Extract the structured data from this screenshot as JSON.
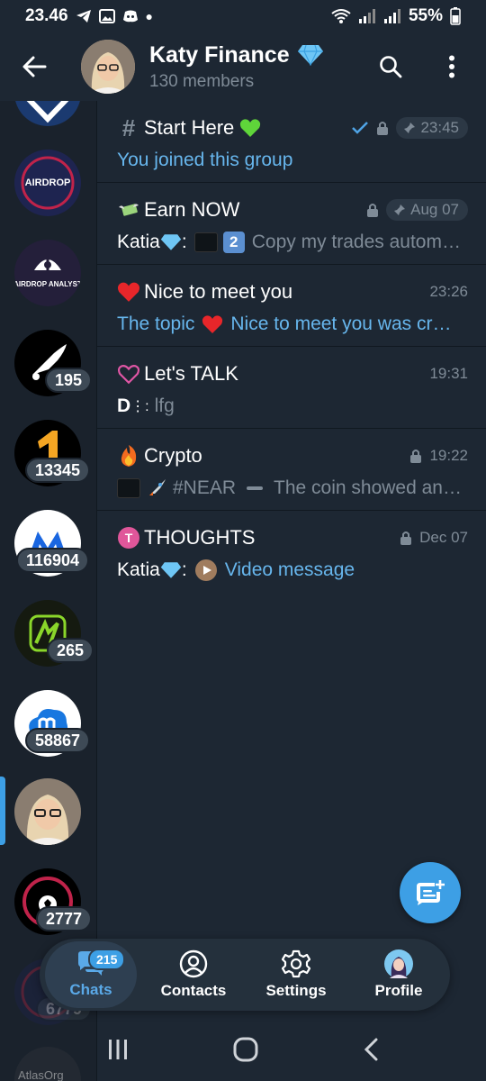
{
  "status_bar": {
    "time": "23.46",
    "battery": "55%"
  },
  "header": {
    "title": "Katy Finance",
    "subtitle": "130 members"
  },
  "rail": {
    "badges": [
      "195",
      "13345",
      "116904",
      "265",
      "58867",
      "2777"
    ],
    "faded_badge": "6779",
    "bottom_label": "AtlasOrg",
    "airdrop_sat_text": "AIRDROP",
    "airdrop_analyst_text": "AIRDROP ANALYST"
  },
  "topics": [
    {
      "title": "Start Here",
      "time": "23:45",
      "preview": "You joined this group"
    },
    {
      "title": "Earn NOW",
      "time": "Aug 07",
      "sender": "Katia",
      "preview": "Copy my trades autom…"
    },
    {
      "title": "Nice to meet you",
      "time": "23:26",
      "preview": "The topic",
      "preview_rest": "Nice to meet you was cr…"
    },
    {
      "title": "Let's TALK",
      "time": "19:31",
      "sender": "D",
      "preview": "lfg"
    },
    {
      "title": "Crypto",
      "time": "19:22",
      "preview": "#NEAR",
      "preview_rest": "The coin showed an…"
    },
    {
      "title": "THOUGHTS",
      "time": "Dec 07",
      "sender": "Katia",
      "preview": "Video message",
      "icon_letter": "T"
    }
  ],
  "bottom_nav": {
    "chats": "Chats",
    "chats_badge": "215",
    "contacts": "Contacts",
    "settings": "Settings",
    "profile": "Profile"
  },
  "colors": {
    "background": "#1d2733",
    "accent": "#3d9fe5",
    "link": "#67b6ed"
  }
}
